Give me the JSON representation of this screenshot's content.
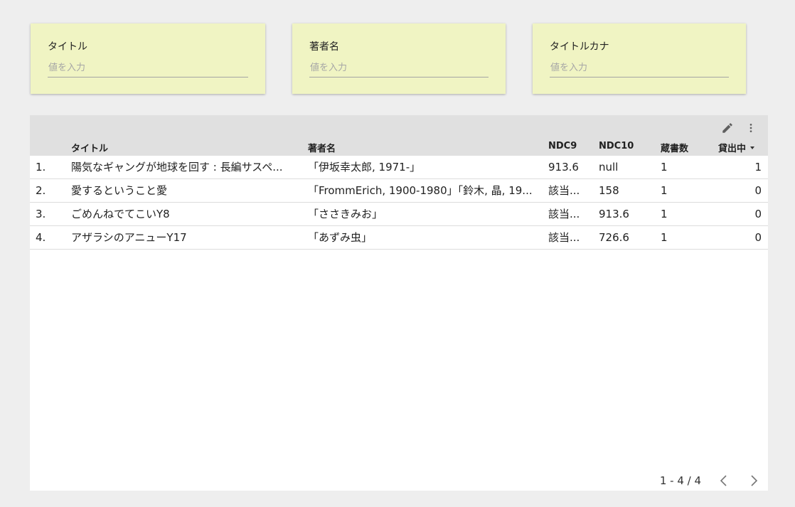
{
  "filters": [
    {
      "label": "タイトル",
      "placeholder": "値を入力",
      "value": ""
    },
    {
      "label": "著者名",
      "placeholder": "値を入力",
      "value": ""
    },
    {
      "label": "タイトルカナ",
      "placeholder": "値を入力",
      "value": ""
    }
  ],
  "table": {
    "columns": {
      "title": "タイトル",
      "author": "著者名",
      "ndc9": "NDC9",
      "ndc10": "NDC10",
      "holdings": "蔵書数",
      "on_loan": "貸出中"
    },
    "sorted_column": "on_loan",
    "sort_direction": "descending",
    "rows": [
      {
        "index": "1.",
        "title": "陽気なギャングが地球を回す : 長編サスペ...",
        "author": "「伊坂幸太郎, 1971-」",
        "ndc9": "913.6",
        "ndc10": "null",
        "holdings": "1",
        "on_loan": "1"
      },
      {
        "index": "2.",
        "title": "愛するということ愛",
        "author": "「FrommErich, 1900-1980」「鈴木, 晶, 19...",
        "ndc9": "該当...",
        "ndc10": "158",
        "holdings": "1",
        "on_loan": "0"
      },
      {
        "index": "3.",
        "title": "ごめんねでてこいY8",
        "author": "「ささきみお」",
        "ndc9": "該当...",
        "ndc10": "913.6",
        "holdings": "1",
        "on_loan": "0"
      },
      {
        "index": "4.",
        "title": "アザラシのアニューY17",
        "author": "「あずみ虫」",
        "ndc9": "該当...",
        "ndc10": "726.6",
        "holdings": "1",
        "on_loan": "0"
      }
    ],
    "pagination": "1 - 4 / 4"
  },
  "icons": {
    "edit": "pencil-icon",
    "more": "more-vert-icon",
    "prev": "chevron-left-icon",
    "next": "chevron-right-icon"
  },
  "colors": {
    "filter_background": "#f0f4c3",
    "header_background": "#e0e0e0",
    "page_background": "#eeeeee"
  }
}
